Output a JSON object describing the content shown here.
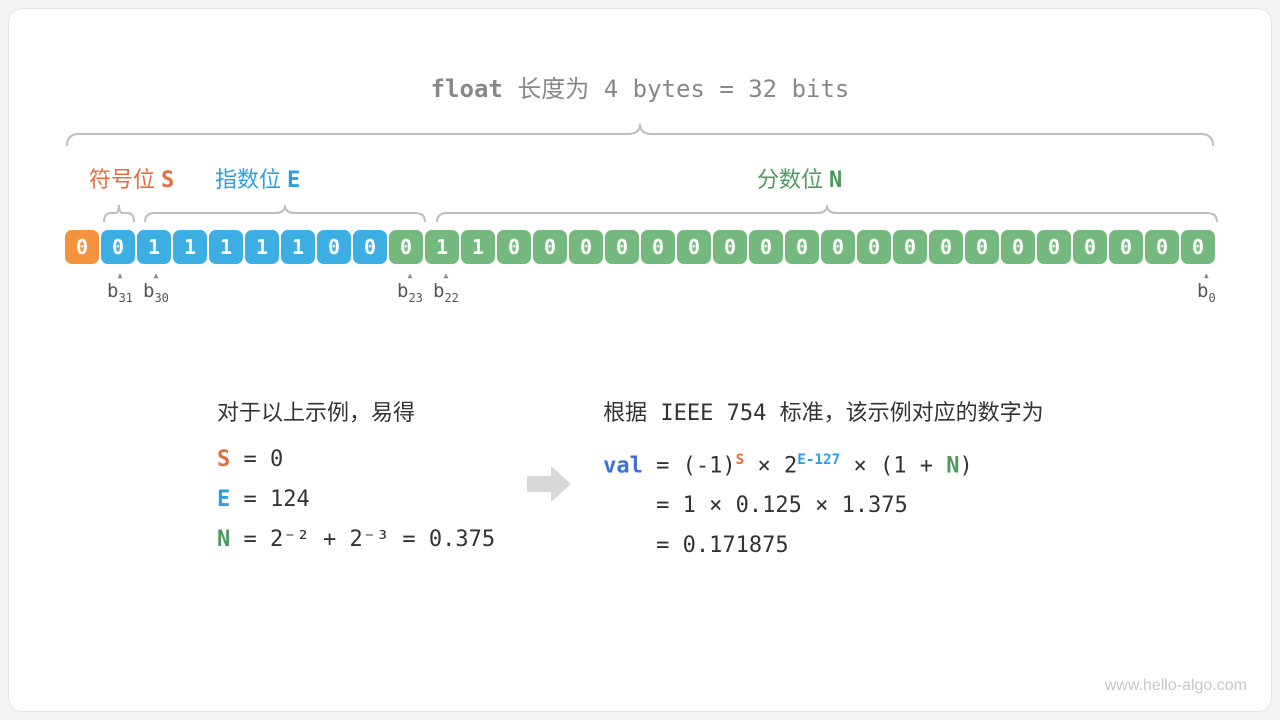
{
  "title": {
    "keyword": "float",
    "rest": " 长度为 4 bytes = 32 bits"
  },
  "sections": {
    "sign": {
      "zh": "符号位",
      "sym": "S",
      "color": "#e96b3a"
    },
    "exponent": {
      "zh": "指数位",
      "sym": "E",
      "color": "#2b9fe0"
    },
    "fraction": {
      "zh": "分数位",
      "sym": "N",
      "color": "#4e9a5e"
    }
  },
  "bits": {
    "sign": [
      "0"
    ],
    "exponent": [
      "0",
      "1",
      "1",
      "1",
      "1",
      "1",
      "0",
      "0"
    ],
    "fraction": [
      "0",
      "1",
      "1",
      "0",
      "0",
      "0",
      "0",
      "0",
      "0",
      "0",
      "0",
      "0",
      "0",
      "0",
      "0",
      "0",
      "0",
      "0",
      "0",
      "0",
      "0",
      "0",
      "0"
    ]
  },
  "bit_indices": {
    "b31": "b31",
    "b30": "b30",
    "b23": "b23",
    "b22": "b22",
    "b0": "b0"
  },
  "left_block": {
    "header": "对于以上示例，易得",
    "s_line": {
      "sym": "S",
      "eq": " = 0"
    },
    "e_line": {
      "sym": "E",
      "eq": " = 124"
    },
    "n_line": {
      "sym": "N",
      "eq": " = 2⁻² + 2⁻³ = 0.375"
    }
  },
  "right_block": {
    "header": "根据 IEEE 754 标准，该示例对应的数字为",
    "l1": {
      "val": "val",
      "pre": " = (-1)",
      "s": "S",
      "mid": " × 2",
      "e": "E-127",
      "post": " × (1 + ",
      "n": "N",
      "close": ")"
    },
    "l2": "    = 1 × 0.125 × 1.375",
    "l3": "    = 0.171875"
  },
  "watermark": "www.hello-algo.com"
}
